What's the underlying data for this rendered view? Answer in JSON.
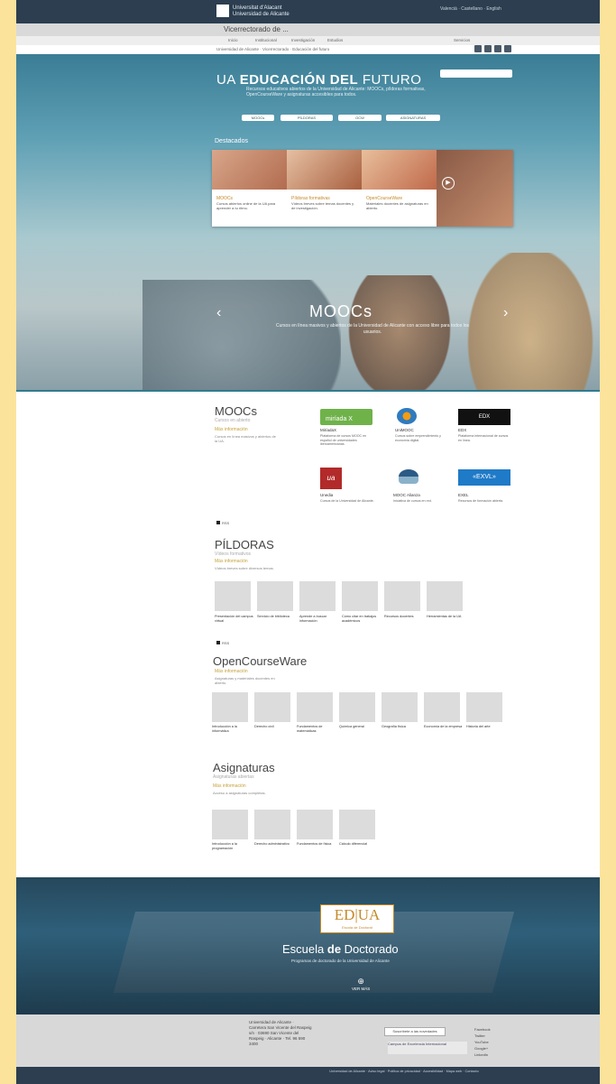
{
  "header": {
    "logo_line1": "Universitat d'Alacant",
    "logo_line2": "Universidad de Alicante",
    "top_links": "Valencià · Castellano · English",
    "vicerrectorado": "Vicerrectorado de ...",
    "nav": [
      "Inicio",
      "Institucional",
      "Investigación",
      "Estudios",
      "Servicios"
    ],
    "breadcrumb": "Universidad de Alicante · Vicerrectorado · Educación del futuro"
  },
  "hero": {
    "title_prefix": "UA",
    "title_bold": "EDUCACIÓN DEL",
    "title_suffix": "FUTURO",
    "search_placeholder": "",
    "paragraph": "Recursos educativos abiertos de la Universidad de Alicante: MOOCs, píldoras formativas, OpenCourseWare y asignaturas accesibles para todos.",
    "buttons": [
      "MOOCs",
      "PÍLDORAS",
      "OCW",
      "ASIGNATURAS"
    ],
    "destacados_label": "Destacados",
    "features": [
      {
        "title": "MOOCs",
        "text": "Cursos abiertos online de la UA para aprender a tu ritmo."
      },
      {
        "title": "Píldoras formativas",
        "text": "Vídeos breves sobre temas docentes y de investigación."
      },
      {
        "title": "OpenCourseWare",
        "text": "Materiales docentes de asignaturas en abierto."
      }
    ],
    "slide_title": "MOOCs",
    "slide_text": "Cursos en línea masivos y abiertos de la Universidad de Alicante con acceso libre para todos los usuarios."
  },
  "moocs_section": {
    "title": "MOOCs",
    "subtitle": "Cursos en abierto",
    "link": "Más información",
    "desc": "Cursos en línea masivos y abiertos de la UA.",
    "partners": [
      {
        "name": "MiríadaX",
        "logo_text": "miríada X",
        "desc": "Plataforma de cursos MOOC en español de universidades iberoamericanas."
      },
      {
        "name": "UniMOOC",
        "logo_text": "UniMOOC",
        "desc": "Cursos sobre emprendimiento y economía digital."
      },
      {
        "name": "EDX",
        "logo_text": "EDX",
        "desc": "Plataforma internacional de cursos en línea."
      },
      {
        "name": "Unedia",
        "logo_text": "ua",
        "desc": "Cursos de la Universidad de Alicante."
      },
      {
        "name": "MOOC Alianza",
        "logo_text": "",
        "desc": "Iniciativa de cursos en red."
      },
      {
        "name": "EXEL",
        "logo_text": "«EXVL»",
        "desc": "Recursos de formación abierta."
      }
    ],
    "rss": "RSS"
  },
  "pildoras_section": {
    "title": "PÍLDORAS",
    "subtitle": "Vídeos formativos",
    "link": "Más información",
    "desc": "Vídeos breves sobre diversos temas.",
    "items": [
      {
        "label": "Presentación del campus virtual"
      },
      {
        "label": "Servicio de biblioteca"
      },
      {
        "label": "Aprende a buscar información"
      },
      {
        "label": "Cómo citar en trabajos académicos"
      },
      {
        "label": "Recursos docentes"
      },
      {
        "label": "Herramientas de la UA"
      }
    ],
    "rss": "RSS"
  },
  "ocw_section": {
    "title": "OpenCourseWare",
    "subtitle": "Materiales en abierto",
    "link": "Más información",
    "desc": "Asignaturas y materiales docentes en abierto.",
    "items": [
      {
        "label": "Introducción a la informática"
      },
      {
        "label": "Derecho civil"
      },
      {
        "label": "Fundamentos de matemáticas"
      },
      {
        "label": "Química general"
      },
      {
        "label": "Geografía física"
      },
      {
        "label": "Economía de la empresa"
      },
      {
        "label": "Historia del arte"
      }
    ]
  },
  "asignaturas_section": {
    "title": "Asignaturas",
    "subtitle": "Asignaturas abiertas",
    "link": "Más información",
    "desc": "Acceso a asignaturas completas.",
    "items": [
      {
        "label": "Introducción a la programación"
      },
      {
        "label": "Derecho administrativo"
      },
      {
        "label": "Fundamentos de física"
      },
      {
        "label": "Cálculo diferencial"
      }
    ]
  },
  "doctorado": {
    "logo_main": "ED|UA",
    "logo_sub": "Escola de Doctorat",
    "title_prefix": "Escuela",
    "title_bold": "de",
    "title_suffix": "Doctorado",
    "subtitle": "Programas de doctorado de la Universidad de Alicante",
    "ver_mas": "VER MÁS"
  },
  "footer": {
    "address": "Universidad de Alicante · Carretera San Vicente del Raspeig s/n · 03690 San Vicente del Raspeig · Alicante · Tel. 96 590 3400",
    "button": "Suscríbete a las novedades",
    "partner_logo": "Campus de Excelencia Internacional",
    "social": [
      "Facebook",
      "Twitter",
      "YouTube",
      "Google+",
      "LinkedIn"
    ],
    "bottom": "Universidad de Alicante · Aviso legal · Política de privacidad · Accesibilidad · Mapa web · Contacto"
  }
}
